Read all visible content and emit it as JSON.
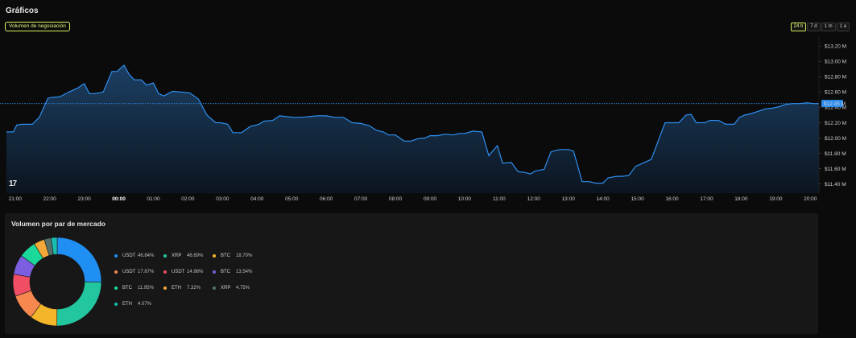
{
  "header": {
    "title": "Gráficos",
    "metric_label": "Volumen de negociación"
  },
  "time_ranges": [
    {
      "label": "24 h",
      "active": true
    },
    {
      "label": "7 d",
      "active": false
    },
    {
      "label": "1 m",
      "active": false
    },
    {
      "label": "1 a",
      "active": false
    }
  ],
  "colors": {
    "accent": "#d9ef5a",
    "line": "#2e8ff0",
    "area_top": "#1c3f63",
    "area_bottom": "#0c1520",
    "current_price_badge": "#2e8ff0"
  },
  "chart_data": {
    "type": "area",
    "title": "",
    "x_ticks": [
      "21:00",
      "22:00",
      "23:00",
      "00:00",
      "01:00",
      "02:00",
      "03:00",
      "04:00",
      "05:00",
      "06:00",
      "07:00",
      "08:00",
      "09:00",
      "10:00",
      "11:00",
      "12:00",
      "13:00",
      "14:00",
      "15:00",
      "16:00",
      "17:00",
      "18:00",
      "19:00",
      "20:00"
    ],
    "x_tick_bold": "00:00",
    "y_ticks": [
      "$13.20 M",
      "$13.00 M",
      "$12.80 M",
      "$12.60 M",
      "$12.40 M",
      "$12.20 M",
      "$12.00 M",
      "$11.80 M",
      "$11.60 M",
      "$11.40 M"
    ],
    "y_tick_values": [
      13.2,
      13.0,
      12.8,
      12.6,
      12.4,
      12.2,
      12.0,
      11.8,
      11.6,
      11.4
    ],
    "ylim": [
      11.28,
      13.34
    ],
    "x_range_hours": [
      20.75,
      44.25
    ],
    "current_value_label": "$12.45 M",
    "current_value": 12.45,
    "x": [
      20.7,
      20.95,
      21.05,
      21.2,
      21.5,
      21.7,
      21.95,
      22.05,
      22.3,
      22.55,
      22.8,
      23.0,
      23.15,
      23.3,
      23.55,
      23.8,
      23.95,
      24.15,
      24.3,
      24.45,
      24.65,
      24.8,
      25.0,
      25.15,
      25.3,
      25.55,
      25.8,
      26.05,
      26.3,
      26.55,
      26.8,
      26.95,
      27.15,
      27.3,
      27.55,
      27.8,
      28.05,
      28.2,
      28.45,
      28.65,
      28.85,
      29.05,
      29.25,
      29.5,
      29.75,
      30.0,
      30.25,
      30.5,
      30.75,
      31.0,
      31.25,
      31.45,
      31.65,
      31.8,
      32.0,
      32.25,
      32.45,
      32.65,
      32.85,
      33.0,
      33.2,
      33.45,
      33.65,
      33.85,
      34.0,
      34.25,
      34.5,
      34.7,
      34.95,
      35.1,
      35.35,
      35.55,
      35.75,
      35.9,
      36.05,
      36.3,
      36.5,
      36.75,
      37.0,
      37.15,
      37.4,
      37.6,
      37.8,
      38.0,
      38.15,
      38.4,
      38.55,
      38.75,
      38.95,
      39.2,
      39.4,
      39.6,
      39.8,
      40.0,
      40.2,
      40.4,
      40.55,
      40.7,
      40.95,
      41.1,
      41.35,
      41.55,
      41.8,
      41.95,
      42.1,
      42.3,
      42.5,
      42.7,
      42.9,
      43.1,
      43.3,
      43.5,
      43.7,
      43.9,
      44.1,
      44.25
    ],
    "values": [
      12.08,
      12.08,
      12.17,
      12.18,
      12.18,
      12.27,
      12.52,
      12.53,
      12.54,
      12.6,
      12.65,
      12.71,
      12.58,
      12.58,
      12.6,
      12.87,
      12.87,
      12.95,
      12.83,
      12.76,
      12.76,
      12.69,
      12.72,
      12.58,
      12.55,
      12.61,
      12.6,
      12.59,
      12.51,
      12.3,
      12.2,
      12.2,
      12.18,
      12.07,
      12.07,
      12.15,
      12.18,
      12.22,
      12.23,
      12.29,
      12.28,
      12.27,
      12.27,
      12.28,
      12.29,
      12.29,
      12.27,
      12.27,
      12.2,
      12.19,
      12.16,
      12.1,
      12.08,
      12.04,
      12.04,
      11.96,
      11.96,
      11.99,
      12.0,
      12.03,
      12.03,
      12.05,
      12.04,
      12.06,
      12.06,
      12.09,
      12.08,
      11.77,
      11.9,
      11.67,
      11.68,
      11.56,
      11.55,
      11.53,
      11.57,
      11.59,
      11.82,
      11.85,
      11.85,
      11.83,
      11.43,
      11.43,
      11.41,
      11.41,
      11.48,
      11.5,
      11.5,
      11.51,
      11.63,
      11.68,
      11.72,
      11.96,
      12.2,
      12.2,
      12.2,
      12.3,
      12.31,
      12.2,
      12.2,
      12.23,
      12.23,
      12.18,
      12.18,
      12.27,
      12.3,
      12.32,
      12.35,
      12.38,
      12.39,
      12.41,
      12.44,
      12.45,
      12.45,
      12.46,
      12.45,
      12.45
    ]
  },
  "market_pairs": {
    "title": "Volumen por par de mercado",
    "chart_data": {
      "type": "pie",
      "slices": [
        {
          "label": "USDT",
          "pct": "46.84%",
          "value": 46.84,
          "color": "#1f8ff3"
        },
        {
          "label": "XRP",
          "pct": "46.69%",
          "value": 46.69,
          "color": "#22c7a0"
        },
        {
          "label": "BTC",
          "pct": "18.70%",
          "value": 18.7,
          "color": "#f3b62b"
        },
        {
          "label": "USDT",
          "pct": "17.87%",
          "value": 17.87,
          "color": "#f5874f"
        },
        {
          "label": "USDT",
          "pct": "14.98%",
          "value": 14.98,
          "color": "#f14d64"
        },
        {
          "label": "BTC",
          "pct": "13.54%",
          "value": 13.54,
          "color": "#7b5fe0"
        },
        {
          "label": "BTC",
          "pct": "11.95%",
          "value": 11.95,
          "color": "#1bd99b"
        },
        {
          "label": "ETH",
          "pct": "7.32%",
          "value": 7.32,
          "color": "#f3a93a"
        },
        {
          "label": "XRP",
          "pct": "4.75%",
          "value": 4.75,
          "color": "#55706a"
        },
        {
          "label": "ETH",
          "pct": "4.07%",
          "value": 4.07,
          "color": "#19bfae"
        }
      ]
    }
  }
}
